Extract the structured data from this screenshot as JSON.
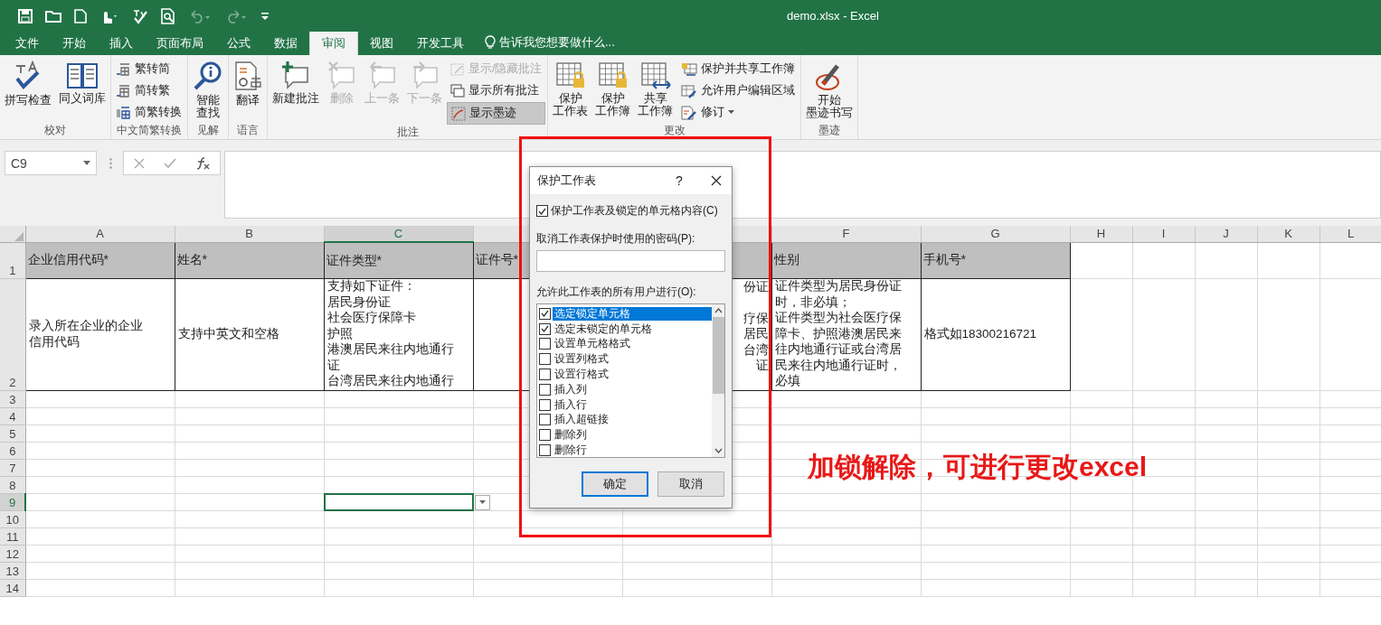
{
  "window": {
    "title": "demo.xlsx - Excel"
  },
  "tabs": [
    {
      "label": "文件",
      "selected": false
    },
    {
      "label": "开始",
      "selected": false
    },
    {
      "label": "插入",
      "selected": false
    },
    {
      "label": "页面布局",
      "selected": false
    },
    {
      "label": "公式",
      "selected": false
    },
    {
      "label": "数据",
      "selected": false
    },
    {
      "label": "审阅",
      "selected": true
    },
    {
      "label": "视图",
      "selected": false
    },
    {
      "label": "开发工具",
      "selected": false
    }
  ],
  "tell_me": "告诉我您想要做什么...",
  "ribbon_groups": [
    {
      "label": "校对",
      "buttons": [
        {
          "label": [
            "拼写检查"
          ],
          "kind": "large",
          "disabled": false,
          "on": false
        },
        {
          "label": [
            "同义词库"
          ],
          "kind": "large",
          "disabled": false,
          "on": false
        }
      ]
    },
    {
      "label": "中文简繁转换",
      "buttons": [
        {
          "label": [
            "繁转简"
          ],
          "kind": "small",
          "disabled": false,
          "on": false
        },
        {
          "label": [
            "简转繁"
          ],
          "kind": "small",
          "disabled": false,
          "on": false
        },
        {
          "label": [
            "简繁转换"
          ],
          "kind": "small",
          "disabled": false,
          "on": false
        }
      ]
    },
    {
      "label": "见解",
      "buttons": [
        {
          "label": [
            "智能",
            "查找"
          ],
          "kind": "large",
          "disabled": false,
          "on": false
        }
      ]
    },
    {
      "label": "语言",
      "buttons": [
        {
          "label": [
            "翻译"
          ],
          "kind": "large",
          "disabled": false,
          "on": false
        }
      ]
    },
    {
      "label": "批注",
      "buttons": [
        {
          "label": [
            "新建批注"
          ],
          "kind": "large",
          "disabled": false,
          "on": false
        },
        {
          "label": [
            "删除"
          ],
          "kind": "large",
          "disabled": true,
          "on": false
        },
        {
          "label": [
            "上一条"
          ],
          "kind": "large",
          "disabled": true,
          "on": false
        },
        {
          "label": [
            "下一条"
          ],
          "kind": "large",
          "disabled": true,
          "on": false
        },
        {
          "label": [
            "显示/隐藏批注"
          ],
          "kind": "small",
          "disabled": true,
          "on": false
        },
        {
          "label": [
            "显示所有批注"
          ],
          "kind": "small",
          "disabled": false,
          "on": false
        },
        {
          "label": [
            "显示墨迹"
          ],
          "kind": "small",
          "disabled": false,
          "on": true
        }
      ]
    },
    {
      "label": "更改",
      "buttons": [
        {
          "label": [
            "保护",
            "工作表"
          ],
          "kind": "large",
          "disabled": false,
          "on": false
        },
        {
          "label": [
            "保护",
            "工作簿"
          ],
          "kind": "large",
          "disabled": false,
          "on": false
        },
        {
          "label": [
            "共享",
            "工作簿"
          ],
          "kind": "large",
          "disabled": false,
          "on": false
        },
        {
          "label": [
            "保护并共享工作簿"
          ],
          "kind": "small",
          "disabled": false,
          "on": false
        },
        {
          "label": [
            "允许用户编辑区域"
          ],
          "kind": "small",
          "disabled": false,
          "on": false
        },
        {
          "label": [
            "修订"
          ],
          "kind": "small_menu",
          "disabled": false,
          "on": false
        }
      ]
    },
    {
      "label": "墨迹",
      "buttons": [
        {
          "label": [
            "开始",
            "墨迹书写"
          ],
          "kind": "large",
          "disabled": false,
          "on": false
        }
      ]
    }
  ],
  "formula_bar": {
    "name_box": "C9"
  },
  "sheet": {
    "columns": [
      {
        "letter": "A",
        "selected": false
      },
      {
        "letter": "B",
        "selected": false
      },
      {
        "letter": "C",
        "selected": true
      },
      {
        "selected": false
      },
      {
        "selected": false
      },
      {
        "letter": "F",
        "selected": false
      },
      {
        "letter": "G",
        "selected": false
      },
      {
        "letter": "H",
        "selected": false
      },
      {
        "letter": "I",
        "selected": false
      },
      {
        "letter": "J",
        "selected": false
      },
      {
        "letter": "K",
        "selected": false
      },
      {
        "letter": "L",
        "selected": false
      }
    ],
    "rows": [
      {
        "number": "1",
        "kind": "header",
        "selected": false,
        "cells": [
          {
            "lines": [
              "企业信用代码*"
            ]
          },
          {
            "lines": [
              "姓名*"
            ]
          },
          {
            "lines": [
              "证件类型*"
            ]
          },
          {
            "lines": [
              "证件号*"
            ]
          },
          {},
          {
            "lines": [
              "性别"
            ]
          },
          {
            "lines": [
              "手机号*"
            ]
          }
        ]
      },
      {
        "number": "2",
        "kind": "data",
        "selected": false,
        "cells": [
          {
            "lines": [
              "录入所在企业的企业",
              "信用代码"
            ],
            "kind": "text"
          },
          {
            "lines": [
              "支持中英文和空格"
            ],
            "kind": "text"
          },
          {
            "lines": [
              "支持如下证件：",
              "居民身份证",
              "社会医疗保障卡",
              "护照",
              "港澳居民来往内地通行",
              "证",
              "台湾居民来往内地通行"
            ],
            "kind": "text"
          },
          {},
          {
            "lines": [
              "份证",
              "疗保",
              "居民",
              "台湾",
              "证"
            ],
            "kind": "overflow"
          },
          {
            "lines": [
              "证件类型为居民身份证",
              "时，非必填；",
              "证件类型为社会医疗保",
              "障卡、护照港澳居民来",
              "往内地通行证或台湾居",
              "民来往内地通行证时，",
              "必填"
            ],
            "kind": "text"
          },
          {
            "lines": [
              "格式如18300216721"
            ],
            "kind": "text"
          }
        ]
      },
      {
        "number": "3",
        "kind": "empty",
        "selected": false
      },
      {
        "number": "4",
        "kind": "empty",
        "selected": false
      },
      {
        "number": "5",
        "kind": "empty",
        "selected": false
      },
      {
        "number": "6",
        "kind": "empty",
        "selected": false
      },
      {
        "number": "7",
        "kind": "empty",
        "selected": false
      },
      {
        "number": "8",
        "kind": "empty",
        "selected": false
      },
      {
        "number": "9",
        "kind": "empty",
        "selected": true
      },
      {
        "number": "10",
        "kind": "empty",
        "selected": false
      },
      {
        "number": "11",
        "kind": "empty",
        "selected": false
      },
      {
        "number": "12",
        "kind": "empty",
        "selected": false
      },
      {
        "number": "13",
        "kind": "empty",
        "selected": false
      },
      {
        "number": "14",
        "kind": "empty",
        "selected": false
      }
    ]
  },
  "dialog": {
    "title": "保护工作表",
    "help": "?",
    "protect_option": {
      "label": "保护工作表及锁定的单元格内容(C)",
      "checked": true
    },
    "password_label": "取消工作表保护时使用的密码(P):",
    "permissions_label": "允许此工作表的所有用户进行(O):",
    "permissions": [
      {
        "label": "选定锁定单元格",
        "checked": true,
        "selected": true
      },
      {
        "label": "选定未锁定的单元格",
        "checked": true,
        "selected": false
      },
      {
        "label": "设置单元格格式",
        "checked": false,
        "selected": false
      },
      {
        "label": "设置列格式",
        "checked": false,
        "selected": false
      },
      {
        "label": "设置行格式",
        "checked": false,
        "selected": false
      },
      {
        "label": "插入列",
        "checked": false,
        "selected": false
      },
      {
        "label": "插入行",
        "checked": false,
        "selected": false
      },
      {
        "label": "插入超链接",
        "checked": false,
        "selected": false
      },
      {
        "label": "删除列",
        "checked": false,
        "selected": false
      },
      {
        "label": "删除行",
        "checked": false,
        "selected": false
      }
    ],
    "buttons": [
      {
        "label": "确定",
        "default": true
      },
      {
        "label": "取消",
        "default": false
      }
    ]
  },
  "annotation": {
    "text": "加锁解除，可进行更改excel"
  }
}
